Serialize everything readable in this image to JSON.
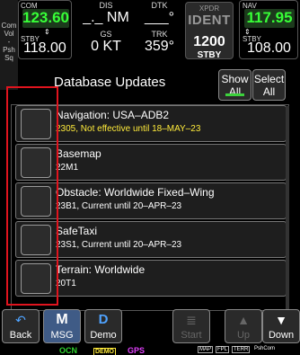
{
  "knob": {
    "com_label": "Com",
    "vol_label": "Vol",
    "psh_label": "Psh",
    "sq_label": "Sq"
  },
  "com": {
    "label": "COM",
    "active": "123.60",
    "stby_label": "STBY",
    "stby": "118.00"
  },
  "dis": {
    "label": "DIS",
    "value": "_._ NM"
  },
  "dtk": {
    "label": "DTK",
    "value": "___°"
  },
  "gs": {
    "label": "GS",
    "value": "0 KT"
  },
  "trk": {
    "label": "TRK",
    "value": "359°"
  },
  "xpdr": {
    "label": "XPDR",
    "mode": "IDENT",
    "code": "1200",
    "stby": "STBY"
  },
  "nav": {
    "label": "NAV",
    "active": "117.95",
    "stby_label": "STBY",
    "stby": "108.00"
  },
  "page": {
    "title": "Database Updates",
    "show_all": [
      "Show",
      "All"
    ],
    "select_all": [
      "Select",
      "All"
    ]
  },
  "databases": [
    {
      "name": "Navigation: USA–ADB2",
      "status": "2305, Not effective until 18–MAY–23",
      "warn": true
    },
    {
      "name": "Basemap",
      "status": "22M1",
      "warn": false
    },
    {
      "name": "Obstacle: Worldwide Fixed–Wing",
      "status": "23B1, Current until 20–APR–23",
      "warn": false
    },
    {
      "name": "SafeTaxi",
      "status": "23S1, Current until 20–APR–23",
      "warn": false
    },
    {
      "name": "Terrain: Worldwide",
      "status": "20T1",
      "warn": false
    }
  ],
  "bottom": {
    "back": "Back",
    "msg_icon": "M",
    "msg": "MSG",
    "demo_icon": "D",
    "demo": "Demo",
    "start": "Start",
    "up": "Up",
    "down": "Down"
  },
  "annunciators": {
    "ocn": "OCN",
    "demo": "DEMO",
    "gps": "GPS",
    "map": "MAP",
    "fpl": "FPL",
    "terr": "TERR",
    "pshcom": "PshCom"
  },
  "colors": {
    "active_freq": "#37ff37",
    "warn_text": "#ffeb3b",
    "highlight_outline": "#e0141e",
    "msg_button": "#3f5b86",
    "ocn": "#2fd42f",
    "demo_annunciator": "#ffeb3b",
    "gps": "#e040fb"
  }
}
